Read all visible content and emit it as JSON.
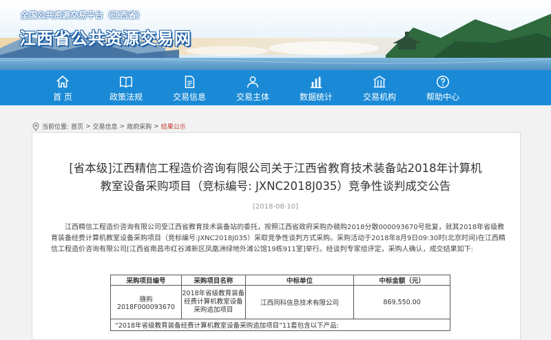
{
  "banner": {
    "subtitle": "全国公共资源交易平台（江西省）",
    "title": "江西省公共资源交易网"
  },
  "nav": {
    "items": [
      {
        "label": "首 页",
        "icon": "home-icon"
      },
      {
        "label": "政策法规",
        "icon": "book-icon"
      },
      {
        "label": "交易信息",
        "icon": "document-icon"
      },
      {
        "label": "交易主体",
        "icon": "person-icon"
      },
      {
        "label": "数据统计",
        "icon": "bar-chart-icon"
      },
      {
        "label": "交易机构",
        "icon": "building-icon"
      },
      {
        "label": "帮助中心",
        "icon": "help-icon"
      }
    ]
  },
  "breadcrumb": {
    "prefix": "当前位置:",
    "items": [
      "首页",
      "交易信息",
      "政府采购",
      "结果公示"
    ],
    "sep": ">"
  },
  "article": {
    "title_line1": "[省本级]江西精信工程造价咨询有限公司关于江西省教育技术装备站2018年计算机",
    "title_line2": "教室设备采购项目（竞标编号: JXNC2018J035）竞争性谈判成交公告",
    "date": "[2018-08-10]",
    "body": "江西精信工程造价咨询有限公司受江西省教育技术装备站的委托，按照江西省政府采购办赣购2018分散000093670号批复，就其2018年省级教育装备经费计算机教室设备采购项目（竞标编号:JXNC2018J035）采取竞争性谈判方式采购。采购活动于2018年8月9日09:30时(北京时间)在江西精信工程造价咨询有限公司[江西省南昌市红谷滩新区凤凰洲绿地外滩公馆19栋911室]举行。经谈判专家组评定，采购人确认，成交结果如下:"
  },
  "result_table": {
    "headers": [
      "采购项目编号",
      "采购项目名称",
      "中标单位",
      "中标金额（元）"
    ],
    "rows": [
      [
        "赣购2018F000093670",
        "2018年省级教育装备经费计算机教室设备采购追加项目",
        "江西同科信息技术有限公司",
        "869,550.00"
      ]
    ],
    "note": "“2018年省级教育装备经费计算机教室设备采购追加项目”11套包含以下产品:"
  },
  "colors": {
    "nav_bg": "#1a8ad6",
    "current_crumb": "#c0392b"
  }
}
